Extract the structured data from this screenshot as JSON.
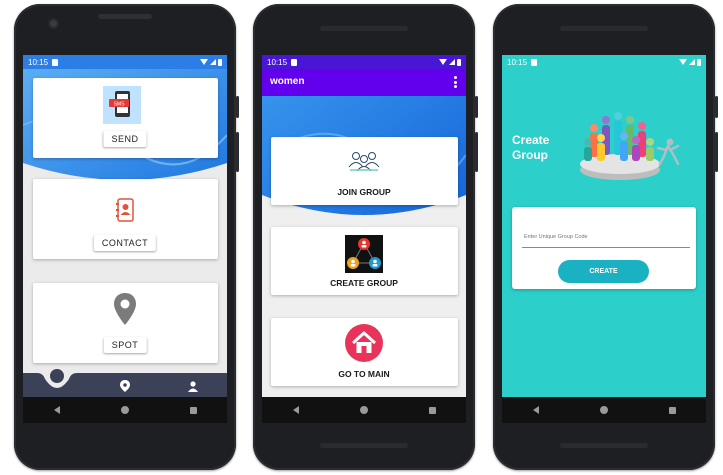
{
  "status": {
    "time": "10:15"
  },
  "screen1": {
    "cards": [
      {
        "label": "SEND"
      },
      {
        "label": "CONTACT"
      },
      {
        "label": "SPOT"
      }
    ]
  },
  "screen2": {
    "title": "women",
    "cards": [
      {
        "label": "JOIN GROUP"
      },
      {
        "label": "CREATE GROUP"
      },
      {
        "label": "GO TO MAIN"
      }
    ]
  },
  "screen3": {
    "heading": "Create Group",
    "input_placeholder": "Enter Unique Group Code",
    "button_label": "CREATE"
  },
  "colors": {
    "status_purple": "#6200ee",
    "hero_blue": "#2f8cf0",
    "teal": "#2ccfca",
    "create_button": "#1ab2c2",
    "bottom_nav": "#3b4257"
  }
}
